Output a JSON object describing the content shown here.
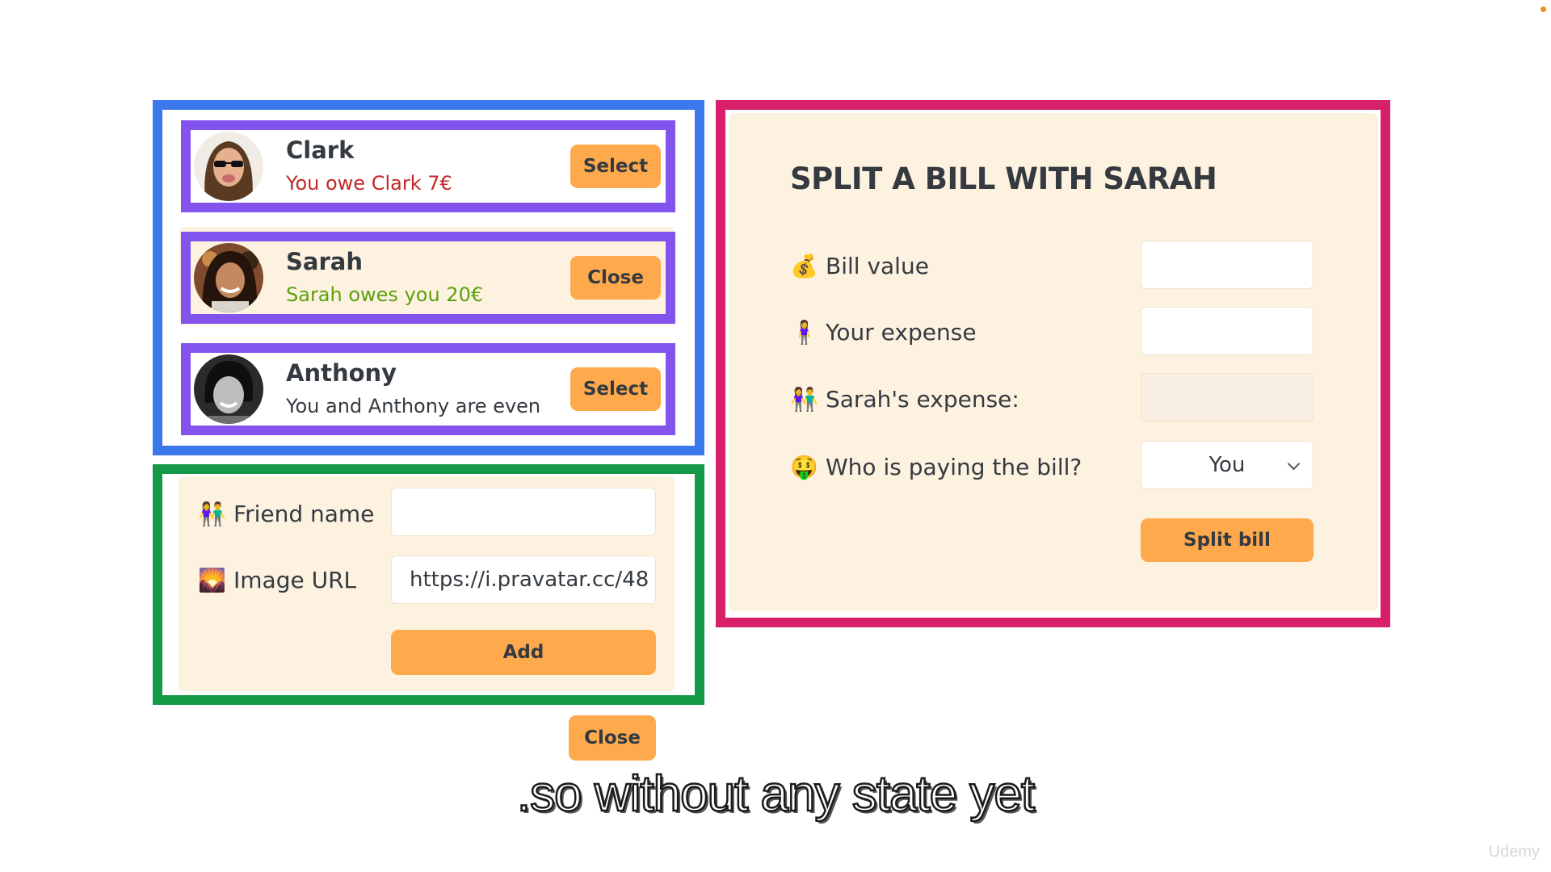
{
  "friends": [
    {
      "name": "Clark",
      "status": "You owe Clark 7€",
      "button": "Select"
    },
    {
      "name": "Sarah",
      "status": "Sarah owes you 20€",
      "button": "Close"
    },
    {
      "name": "Anthony",
      "status": "You and Anthony are even",
      "button": "Select"
    }
  ],
  "add_friend": {
    "name_emoji": "👫",
    "name_label": "Friend name",
    "name_value": "",
    "image_emoji": "🌄",
    "image_label": "Image URL",
    "image_value": "https://i.pravatar.cc/48",
    "add_button": "Add"
  },
  "close_button": "Close",
  "split_bill": {
    "title": "SPLIT A BILL WITH SARAH",
    "bill_emoji": "💰",
    "bill_label": "Bill value",
    "expense_emoji": "🧍‍♀️",
    "expense_label": "Your expense",
    "friend_emoji": "👫",
    "friend_label": "Sarah's expense:",
    "payer_emoji": "🤑",
    "payer_label": "Who is paying the bill?",
    "payer_value": "You",
    "submit_button": "Split bill"
  },
  "caption": ".so without any state yet",
  "watermark": "Udemy",
  "colors": {
    "accent": "#ffa94d",
    "panel": "#fdf2e0",
    "frame_blue": "#3b78ec",
    "frame_green": "#159947",
    "frame_red": "#d81f6a",
    "frame_purple": "#8353ee",
    "owe_red": "#c42727",
    "owed_green": "#5aa10e"
  }
}
